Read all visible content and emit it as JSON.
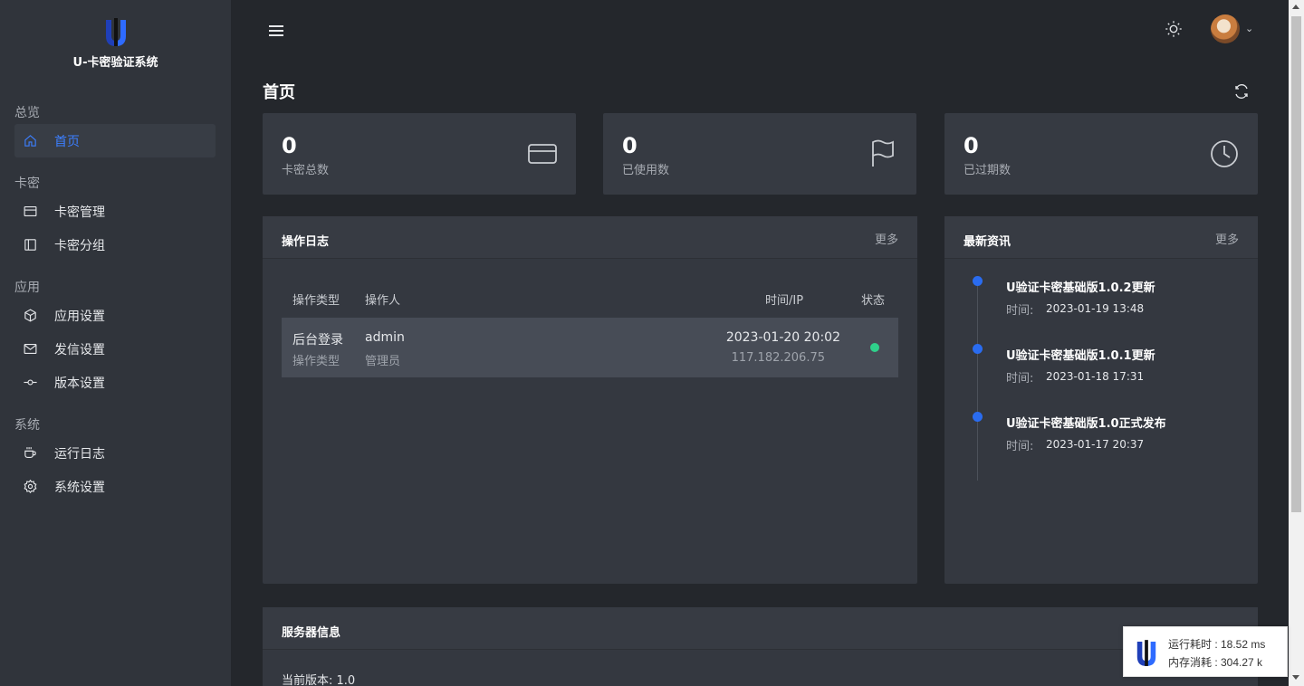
{
  "app": {
    "title": "U-卡密验证系统"
  },
  "sidebar": {
    "sections": [
      {
        "label": "总览"
      },
      {
        "label": "卡密"
      },
      {
        "label": "应用"
      },
      {
        "label": "系统"
      }
    ],
    "items": [
      {
        "label": "首页",
        "icon": "home-icon"
      },
      {
        "label": "卡密管理",
        "icon": "card-icon"
      },
      {
        "label": "卡密分组",
        "icon": "sidebar-layout-icon"
      },
      {
        "label": "应用设置",
        "icon": "box-icon"
      },
      {
        "label": "发信设置",
        "icon": "mail-icon"
      },
      {
        "label": "版本设置",
        "icon": "commit-icon"
      },
      {
        "label": "运行日志",
        "icon": "coffee-icon"
      },
      {
        "label": "系统设置",
        "icon": "gear-icon"
      }
    ],
    "active_index": 0
  },
  "header": {
    "page_title": "首页"
  },
  "stats": [
    {
      "value": "0",
      "label": "卡密总数",
      "icon": "credit-card-icon"
    },
    {
      "value": "0",
      "label": "已使用数",
      "icon": "flag-icon"
    },
    {
      "value": "0",
      "label": "已过期数",
      "icon": "clock-icon"
    }
  ],
  "log_panel": {
    "title": "操作日志",
    "more": "更多",
    "columns": [
      "操作类型",
      "操作人",
      "时间/IP",
      "状态"
    ],
    "rows": [
      {
        "type": "后台登录",
        "type_sub": "操作类型",
        "user": "admin",
        "user_sub": "管理员",
        "time": "2023-01-20 20:02",
        "ip": "117.182.206.75",
        "status": "success"
      }
    ]
  },
  "news_panel": {
    "title": "最新资讯",
    "more": "更多",
    "time_label": "时间:",
    "items": [
      {
        "title": "U验证卡密基础版1.0.2更新",
        "time": "2023-01-19 13:48"
      },
      {
        "title": "U验证卡密基础版1.0.1更新",
        "time": "2023-01-18 17:31"
      },
      {
        "title": "U验证卡密基础版1.0正式发布",
        "time": "2023-01-17 20:37"
      }
    ]
  },
  "server_panel": {
    "title": "服务器信息",
    "version_label": "当前版本:",
    "version": "1.0"
  },
  "debug": {
    "runtime_label": "运行耗时 : 18.52 ms",
    "memory_label": "内存消耗 : 304.27 k"
  },
  "colors": {
    "accent": "#3c7fff",
    "status_ok": "#2fd08b",
    "timeline_dot": "#2a6cf0"
  }
}
